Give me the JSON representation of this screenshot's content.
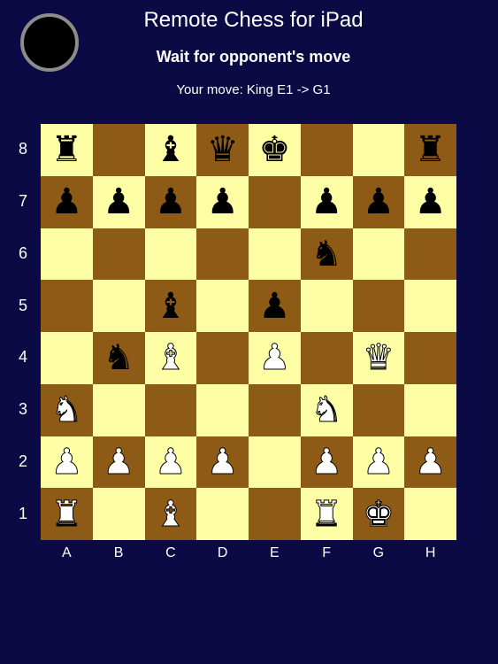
{
  "header": {
    "title": "Remote Chess for iPad",
    "status": "Wait for opponent's move",
    "last_move": "Your move: King E1 -> G1",
    "turn_indicator_color": "black"
  },
  "colors": {
    "background": "#0b0a45",
    "light_square": "#fefea4",
    "dark_square": "#8e5b16"
  },
  "board": {
    "files": [
      "A",
      "B",
      "C",
      "D",
      "E",
      "F",
      "G",
      "H"
    ],
    "ranks": [
      "8",
      "7",
      "6",
      "5",
      "4",
      "3",
      "2",
      "1"
    ],
    "rows": [
      [
        "black-rook",
        "",
        "black-bishop",
        "black-queen",
        "black-king",
        "",
        "",
        "black-rook"
      ],
      [
        "black-pawn",
        "black-pawn",
        "black-pawn",
        "black-pawn",
        "",
        "black-pawn",
        "black-pawn",
        "black-pawn"
      ],
      [
        "",
        "",
        "",
        "",
        "",
        "black-knight",
        "",
        ""
      ],
      [
        "",
        "",
        "black-bishop",
        "",
        "black-pawn",
        "",
        "",
        ""
      ],
      [
        "",
        "black-knight",
        "white-bishop",
        "",
        "white-pawn",
        "",
        "white-queen",
        ""
      ],
      [
        "white-knight",
        "",
        "",
        "",
        "",
        "white-knight",
        "",
        ""
      ],
      [
        "white-pawn",
        "white-pawn",
        "white-pawn",
        "white-pawn",
        "",
        "white-pawn",
        "white-pawn",
        "white-pawn"
      ],
      [
        "white-rook",
        "",
        "white-bishop",
        "",
        "",
        "white-rook",
        "white-king",
        ""
      ]
    ]
  }
}
